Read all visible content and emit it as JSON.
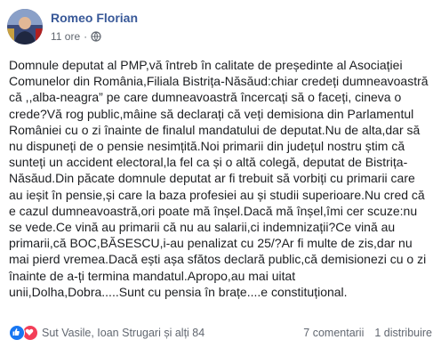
{
  "post": {
    "author": "Romeo Florian",
    "time": "11 ore",
    "separator": "·",
    "body_lines": [
      "Domnule deputat al PMP,vă întreb în calitate de președinte al Asociației",
      "Comunelor din România,Filiala Bistrița-Năsăud:chiar credeți dumneavoastră",
      "că ,,alba-neagra” pe care dumneavoastră încercați să o faceți, cineva o",
      "crede?Vă rog public,mâine să declarați că veți demisiona din Parlamentul",
      "României cu o zi înainte de finalul mandatului de deputat.Nu de alta,dar să",
      "nu dispuneți de o pensie nesimțită.Noi primarii din județul nostru știm că",
      "sunteți un accident electoral,la fel ca și o altă colegă, deputat de Bistrița-",
      "Năsăud.Din păcate domnule deputat ar fi trebuit să vorbiți cu primarii care",
      "au ieșit în pensie,și care la baza profesiei au și studii superioare.Nu cred că",
      "e cazul dumneavoastră,ori poate mă înșel.Dacă mă înșel,îmi cer scuze:nu",
      "se vede.Ce vină au primarii că nu au salarii,ci indemnizații?Ce vină au",
      "primarii,că BOC,BĂSESCU,i-au penalizat cu 25/?Ar fi multe de zis,dar nu",
      "mai pierd vremea.Dacă ești așa sfătos declară public,că demisionezi cu o zi",
      "înainte de a-ți termina mandatul.Apropo,au mai uitat",
      "unii,Dolha,Dobra.....Sunt cu pensia în brațe....e constituțional."
    ]
  },
  "footer": {
    "reactors": "Sut Vasile, Ioan Strugari și alți 84",
    "comments": "7 comentarii",
    "shares": "1 distribuire"
  },
  "colors": {
    "author_blue": "#385898",
    "like_blue": "#1877f2",
    "love_red": "#f33e58",
    "meta_gray": "#616770"
  },
  "icons": {
    "audience": "globe-icon",
    "reaction_1": "like-icon",
    "reaction_2": "love-icon"
  }
}
